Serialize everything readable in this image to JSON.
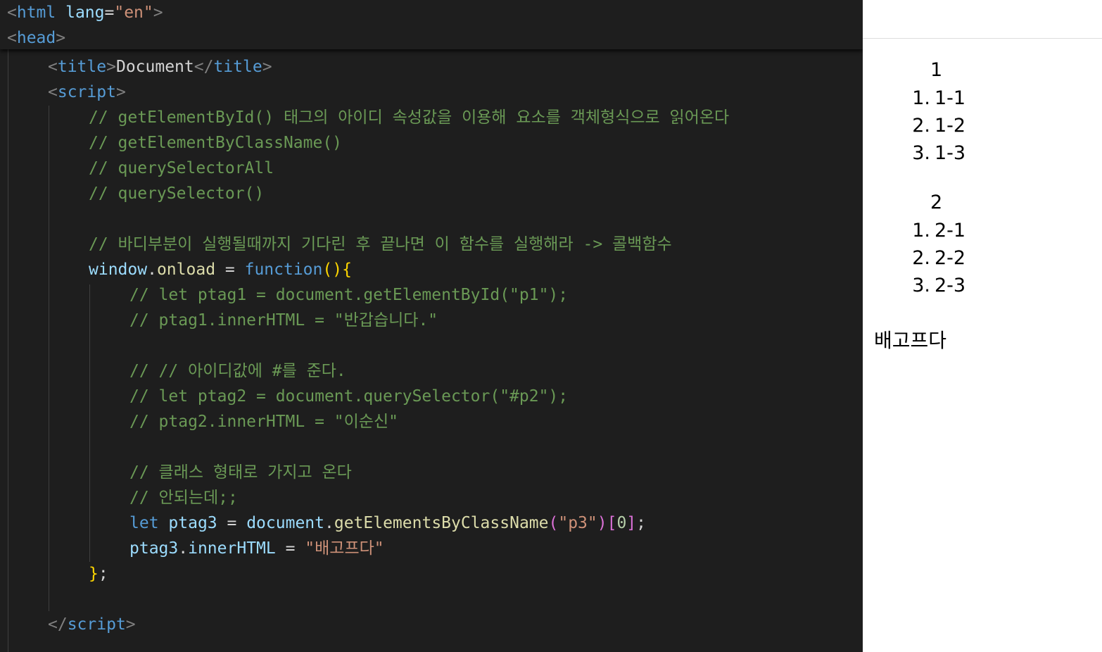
{
  "editor": {
    "sticky": {
      "html_lang_value": "\"en\"",
      "html_tag": "html",
      "lang_attr": "lang",
      "head_tag": "head"
    },
    "title_tag": "title",
    "title_text": "Document",
    "script_tag": "script",
    "comments": {
      "c1": "// getElementById() 태그의 아이디 속성값을 이용해 요소를 객체형식으로 읽어온다",
      "c2": "// getElementByClassName()",
      "c3": "// querySelectorAll",
      "c4": "// querySelector()",
      "c5": "// 바디부분이 실행될때까지 기다린 후 끝나면 이 함수를 실행해라 -> 콜백함수",
      "c6": "// let ptag1 = document.getElementById(\"p1\");",
      "c7": "// ptag1.innerHTML = \"반갑습니다.\"",
      "c8": "// // 아이디값에 #를 준다.",
      "c9": "// let ptag2 = document.querySelector(\"#p2\");",
      "c10": "// ptag2.innerHTML = \"이순신\"",
      "c11": "// 클래스 형태로 가지고 온다",
      "c12": "// 안되는데;;"
    },
    "code": {
      "window": "window",
      "onload": "onload",
      "function_kw": "function",
      "let_kw": "let",
      "ptag3": "ptag3",
      "document": "document",
      "get_by_class": "getElementsByClassName",
      "p3_str": "\"p3\"",
      "index": "0",
      "innerHTML": "innerHTML",
      "assigned_str": "\"배고프다\""
    }
  },
  "preview": {
    "list1": {
      "heading": "1",
      "items": [
        {
          "num": "1.",
          "text": "1-1"
        },
        {
          "num": "2.",
          "text": "1-2"
        },
        {
          "num": "3.",
          "text": "1-3"
        }
      ]
    },
    "list2": {
      "heading": "2",
      "items": [
        {
          "num": "1.",
          "text": "2-1"
        },
        {
          "num": "2.",
          "text": "2-2"
        },
        {
          "num": "3.",
          "text": "2-3"
        }
      ]
    },
    "paragraph": "배고프다"
  },
  "colors": {
    "editor_bg": "#1e1e1e",
    "comment": "#6a9955",
    "tag": "#569cd6",
    "string": "#ce9178",
    "variable": "#9cdcfe",
    "function": "#dcdcaa",
    "brace": "#ffd700",
    "preview_bg": "#ffffff"
  }
}
